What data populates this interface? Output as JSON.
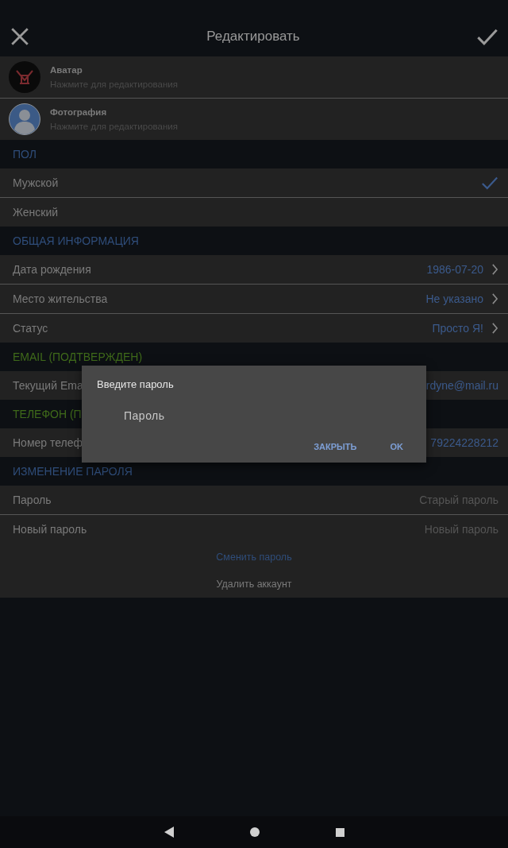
{
  "toolbar": {
    "title": "Редактировать"
  },
  "profile_items": [
    {
      "kind": "avatar",
      "title": "Аватар",
      "subtitle": "Нажмите для редактирования"
    },
    {
      "kind": "photo",
      "title": "Фотография",
      "subtitle": "Нажмите для редактирования"
    }
  ],
  "sections": [
    {
      "title": "ПОЛ",
      "color": "#2f4d7a",
      "rows": [
        {
          "kind": "choice",
          "label": "Мужской",
          "selected": true
        },
        {
          "kind": "choice",
          "label": "Женский",
          "selected": false
        }
      ]
    },
    {
      "title": "ОБЩАЯ ИНФОРМАЦИЯ",
      "color": "#2f4d7a",
      "rows": [
        {
          "kind": "link",
          "label": "Дата рождения",
          "value": "1986-07-20"
        },
        {
          "kind": "link",
          "label": "Место жительства",
          "value": "Не указано"
        },
        {
          "kind": "link",
          "label": "Статус",
          "value": "Просто Я!"
        }
      ]
    },
    {
      "title": "EMAIL (ПОДТВЕРЖДЕН)",
      "color": "#3f6a1a",
      "rows": [
        {
          "kind": "text",
          "label": "Текущий Ema",
          "value": "rdyne@mail.ru"
        }
      ]
    },
    {
      "title": "ТЕЛЕФОН (П",
      "color": "#3f6a1a",
      "rows": [
        {
          "kind": "text",
          "label": "Номер телеф",
          "value": "79224228212"
        }
      ]
    },
    {
      "title": "ИЗМЕНЕНИЕ ПАРОЛЯ",
      "color": "#2f4d7a",
      "rows": [
        {
          "kind": "field",
          "label": "Пароль",
          "placeholder": "Старый пароль"
        },
        {
          "kind": "field",
          "label": "Новый пароль",
          "placeholder": "Новый пароль"
        }
      ]
    }
  ],
  "actions": [
    {
      "kind": "primary",
      "label": "Сменить пароль"
    },
    {
      "kind": "danger",
      "label": "Удалить аккаунт"
    }
  ],
  "dialog": {
    "title": "Введите пароль",
    "field": {
      "placeholder": "Пароль"
    },
    "buttons": [
      "ЗАКРЫТЬ",
      "OK"
    ]
  }
}
